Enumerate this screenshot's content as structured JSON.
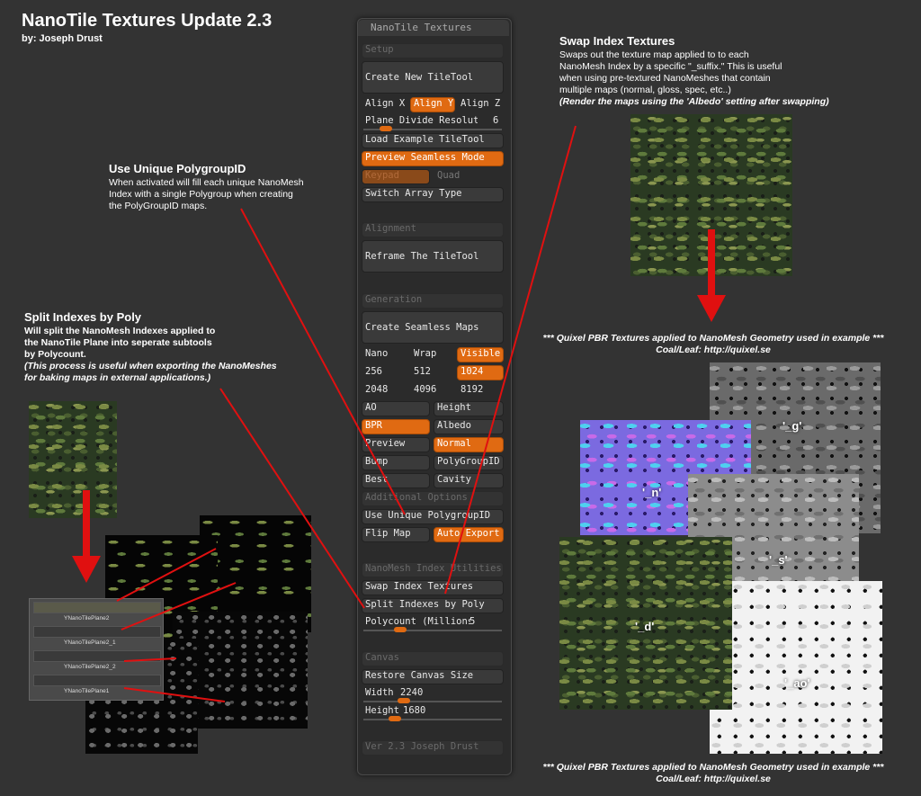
{
  "header": {
    "title": "NanoTile Textures Update 2.3",
    "byline": "by: Joseph Drust"
  },
  "notes": {
    "swap": {
      "heading": "Swap Index Textures",
      "lines": [
        "Swaps out the texture map applied to to each",
        "NanoMesh Index by a specific \"_suffix.\" This is useful",
        "when using pre-textured NanoMeshes that contain",
        "multiple maps (normal, gloss, spec, etc..)"
      ],
      "italic": "(Render the maps using the 'Albedo' setting after swapping)"
    },
    "polygroup": {
      "heading": "Use Unique PolygroupID",
      "lines": [
        "When activated will fill each unique NanoMesh",
        "Index with a single Polygroup when creating",
        "the PolyGroupID maps."
      ]
    },
    "split": {
      "heading": "Split Indexes by Poly",
      "lines": [
        "Will split the NanoMesh Indexes applied to",
        "the NanoTile Plane into seperate subtools",
        "by Polycount."
      ],
      "italic_lines": [
        "(This process is useful when exporting the NanoMeshes",
        "for baking maps in external applications.)"
      ]
    }
  },
  "credits": {
    "line1": "*** Quixel  PBR Textures applied to NanoMesh Geometry used in example ***",
    "line2": "Coal/Leaf: http://quixel.se"
  },
  "texture_labels": {
    "g": "'_g'",
    "n": "'_n'",
    "s": "'_s'",
    "d": "'_d'",
    "ao": "'_ao'"
  },
  "subtools": [
    "YNanoTilePlane2",
    "YNanoTilePlane2_1",
    "YNanoTilePlane2_2",
    "YNanoTilePlane1"
  ],
  "panel": {
    "title": "NanoTile Textures",
    "setup_header": "Setup",
    "create_new": "Create New TileTool",
    "align_x": "Align X",
    "align_y": "Align Y",
    "align_z": "Align Z",
    "plane_divide": "Plane Divide Resolution",
    "plane_divide_value": "6",
    "load_example": "Load Example TileTool",
    "preview_seamless": "Preview Seamless Mode",
    "keypad": "Keypad",
    "quad": "Quad",
    "switch_array": "Switch Array Type",
    "alignment_header": "Alignment",
    "reframe": "Reframe The TileTool",
    "generation_header": "Generation",
    "create_maps": "Create Seamless Maps",
    "nano": "Nano",
    "wrap": "Wrap",
    "visible": "Visible",
    "r256": "256",
    "r512": "512",
    "r1024": "1024",
    "r2048": "2048",
    "r4096": "4096",
    "r8192": "8192",
    "ao": "AO",
    "height": "Height",
    "bpr": "BPR",
    "albedo": "Albedo",
    "preview": "Preview",
    "normal": "Normal",
    "bump": "Bump",
    "polygroupid": "PolyGroupID",
    "best": "Best",
    "cavity": "Cavity",
    "additional_header": "Additional Options",
    "use_unique": "Use Unique PolygroupID",
    "flip_map": "Flip Map",
    "auto_export": "Auto Export",
    "utilities_header": "NanoMesh Index Utilities",
    "swap_index": "Swap Index Textures",
    "split_indexes": "Split Indexes by Poly",
    "polycount_label": "Polycount (Millions)",
    "polycount_value": "5",
    "canvas_header": "Canvas",
    "restore_canvas": "Restore Canvas Size",
    "width_label": "Width",
    "width_value": "2240",
    "height_label": "Height",
    "height_value": "1680",
    "version": "Ver 2.3 Joseph Drust"
  },
  "colors": {
    "accent": "#e06a12",
    "pointer_line": "#e01010",
    "background": "#333333"
  }
}
